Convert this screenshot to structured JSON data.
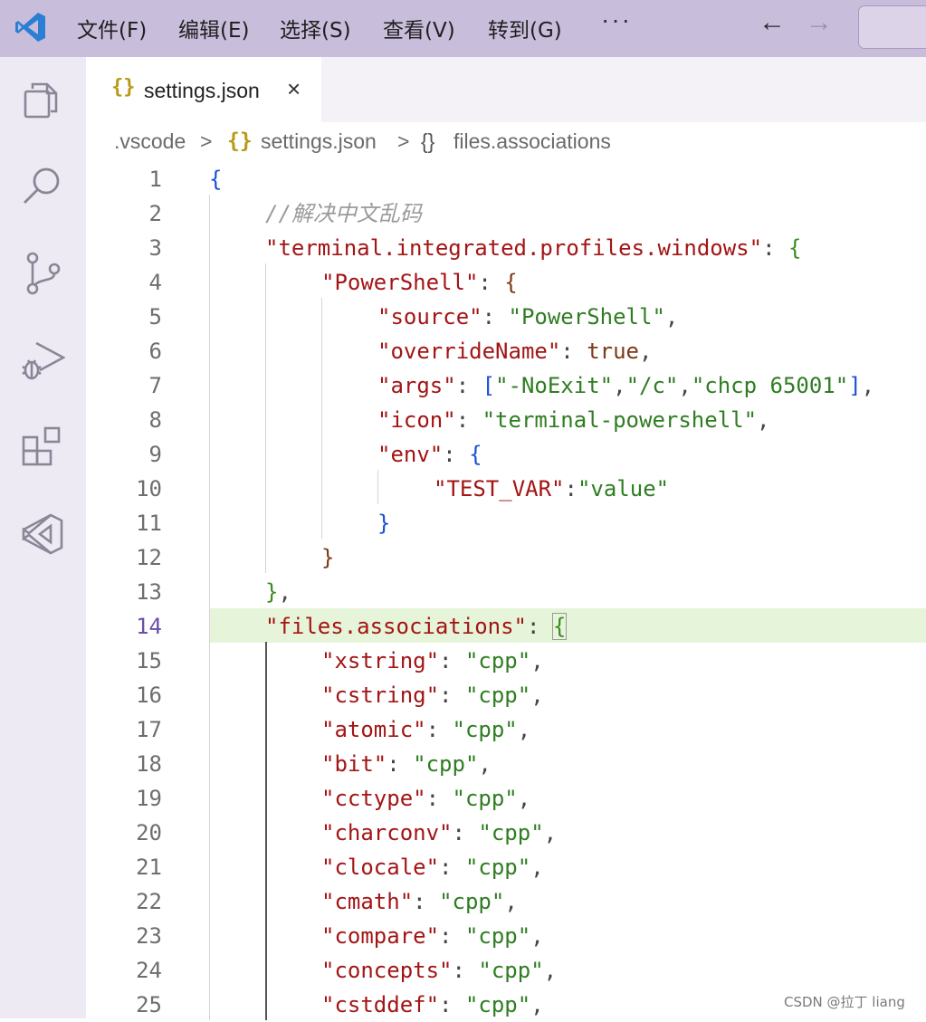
{
  "menu": {
    "items": [
      "文件(F)",
      "编辑(E)",
      "选择(S)",
      "查看(V)",
      "转到(G)"
    ],
    "more": "···",
    "back_arrow": "←",
    "forward_arrow": "→"
  },
  "activity_icons": [
    "explorer-icon",
    "search-icon",
    "source-control-icon",
    "run-debug-icon",
    "extensions-icon",
    "visual-studio-icon"
  ],
  "tab": {
    "label": "settings.json",
    "icon": "{}",
    "close": "×"
  },
  "breadcrumb": {
    "folder": ".vscode",
    "sep": ">",
    "file_icon": "{}",
    "file": "settings.json",
    "symbol_icon": "{}",
    "symbol": "files.associations"
  },
  "editor": {
    "active_line": 14,
    "lines": [
      {
        "n": "1"
      },
      {
        "n": "2"
      },
      {
        "n": "3"
      },
      {
        "n": "4"
      },
      {
        "n": "5"
      },
      {
        "n": "6"
      },
      {
        "n": "7"
      },
      {
        "n": "8"
      },
      {
        "n": "9"
      },
      {
        "n": "10"
      },
      {
        "n": "11"
      },
      {
        "n": "12"
      },
      {
        "n": "13"
      },
      {
        "n": "14"
      },
      {
        "n": "15"
      },
      {
        "n": "16"
      },
      {
        "n": "17"
      },
      {
        "n": "18"
      },
      {
        "n": "19"
      },
      {
        "n": "20"
      },
      {
        "n": "21"
      },
      {
        "n": "22"
      },
      {
        "n": "23"
      },
      {
        "n": "24"
      },
      {
        "n": "25"
      }
    ],
    "text": {
      "l1_open": "{",
      "l2_comment": "//解决中文乱码",
      "l3_key": "\"terminal.integrated.profiles.windows\"",
      "l4_key": "\"PowerShell\"",
      "l5_key": "\"source\"",
      "l5_val": "\"PowerShell\"",
      "l6_key": "\"overrideName\"",
      "l6_val": "true",
      "l7_key": "\"args\"",
      "l7_v1": "\"-NoExit\"",
      "l7_v2": "\"/c\"",
      "l7_v3": "\"chcp 65001\"",
      "l8_key": "\"icon\"",
      "l8_val": "\"terminal-powershell\"",
      "l9_key": "\"env\"",
      "l10_key": "\"TEST_VAR\"",
      "l10_val": "\"value\"",
      "l14_key": "\"files.associations\"",
      "assoc": [
        {
          "k": "\"xstring\"",
          "v": "\"cpp\""
        },
        {
          "k": "\"cstring\"",
          "v": "\"cpp\""
        },
        {
          "k": "\"atomic\"",
          "v": "\"cpp\""
        },
        {
          "k": "\"bit\"",
          "v": "\"cpp\""
        },
        {
          "k": "\"cctype\"",
          "v": "\"cpp\""
        },
        {
          "k": "\"charconv\"",
          "v": "\"cpp\""
        },
        {
          "k": "\"clocale\"",
          "v": "\"cpp\""
        },
        {
          "k": "\"cmath\"",
          "v": "\"cpp\""
        },
        {
          "k": "\"compare\"",
          "v": "\"cpp\""
        },
        {
          "k": "\"concepts\"",
          "v": "\"cpp\""
        },
        {
          "k": "\"cstddef\"",
          "v": "\"cpp\""
        }
      ]
    }
  },
  "watermark": "CSDN @拉丁 liang",
  "colors": {
    "titlebar": "#c9bddc",
    "activitybar": "#eeeaf4",
    "key": "#a31515",
    "string": "#2f7d22",
    "active_line": "#e6f5d9"
  }
}
